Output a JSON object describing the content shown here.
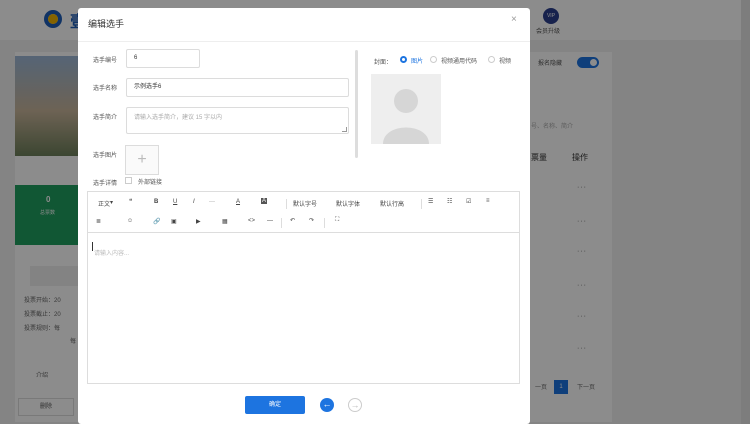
{
  "background": {
    "logo_text": "壹",
    "vip_badge": "VIP",
    "vip_label": "会员升级",
    "vote_count": "0",
    "vote_count_label": "总票数",
    "info_lines": [
      "投票开始：20",
      "投票截止：20",
      "投票规则：每",
      "每"
    ],
    "left_bottom_label": "介绍",
    "delete_button": "删除",
    "toggle_label": "报名隐藏",
    "search_hint": "号、名称、简介",
    "col_header_count": "票量",
    "col_header_action": "操作",
    "row_dots": "···",
    "pager_prev": "一页",
    "pager_current": "1",
    "pager_next": "下一页"
  },
  "modal": {
    "title": "编辑选手",
    "close_icon": "×",
    "fields": {
      "number_label": "选手编号",
      "number_value": "6",
      "name_label": "选手名称",
      "name_value": "示例选手6",
      "intro_label": "选手简介",
      "intro_placeholder": "请输入选手简介，建议 15 字以内",
      "image_label": "选手图片",
      "upload_plus": "+",
      "detail_label": "选手详情",
      "external_link_label": "外部链接"
    },
    "cover": {
      "label": "封面：",
      "options": [
        "图片",
        "视频通用代码",
        "视频"
      ],
      "selected": "图片"
    },
    "toolbar": {
      "row1": [
        "正文",
        "❝",
        "B",
        "U",
        "I",
        "···",
        "A",
        "A",
        "默认字号",
        "默认字体",
        "默认行高",
        "☰",
        "☷",
        "☑",
        "≡"
      ],
      "row2": [
        "≣",
        "☺",
        "🔗",
        "▣",
        "▶",
        "▦",
        "<>",
        "—",
        "↶",
        "↷",
        "⛶"
      ]
    },
    "editor_placeholder": "请输入内容...",
    "confirm_button": "确定",
    "back_icon": "←",
    "forward_icon": "→"
  },
  "colors": {
    "primary": "#1d74e0",
    "overlay": "rgba(0,0,0,0.45)",
    "green_panel": "#1f9e5f"
  }
}
